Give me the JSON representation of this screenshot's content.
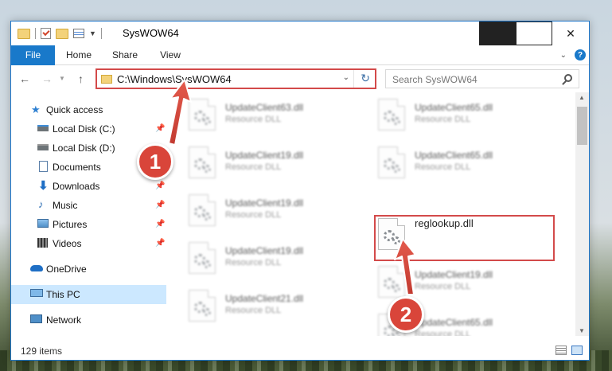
{
  "window": {
    "title": "SysWOW64"
  },
  "ribbon": {
    "tabs": [
      "File",
      "Home",
      "Share",
      "View"
    ]
  },
  "nav": {
    "address": "C:\\Windows\\SysWOW64",
    "search_placeholder": "Search SysWOW64"
  },
  "sidebar": {
    "items": [
      {
        "label": "Quick access",
        "icon": "star-icon"
      },
      {
        "label": "Local Disk (C:)",
        "icon": "drive-icon"
      },
      {
        "label": "Local Disk (D:)",
        "icon": "drive-icon"
      },
      {
        "label": "Documents",
        "icon": "documents-icon"
      },
      {
        "label": "Downloads",
        "icon": "download-icon"
      },
      {
        "label": "Music",
        "icon": "music-icon"
      },
      {
        "label": "Pictures",
        "icon": "pictures-icon"
      },
      {
        "label": "Videos",
        "icon": "videos-icon"
      },
      {
        "label": "OneDrive",
        "icon": "cloud-icon"
      },
      {
        "label": "This PC",
        "icon": "computer-icon"
      },
      {
        "label": "Network",
        "icon": "network-icon"
      }
    ],
    "selected": "This PC"
  },
  "files": {
    "left_column": [
      {
        "name": "UpdateClient63.dll",
        "type": "Resource DLL"
      },
      {
        "name": "UpdateClient19.dll",
        "type": "Resource DLL"
      },
      {
        "name": "UpdateClient19.dll",
        "type": "Resource DLL"
      },
      {
        "name": "UpdateClient19.dll",
        "type": "Resource DLL"
      },
      {
        "name": "UpdateClient21.dll",
        "type": "Resource DLL"
      }
    ],
    "right_column": [
      {
        "name": "UpdateClient65.dll",
        "type": "Resource DLL"
      },
      {
        "name": "UpdateClient65.dll",
        "type": "Resource DLL"
      },
      {
        "name": "reglookup.dll",
        "type": ""
      },
      {
        "name": "UpdateClient19.dll",
        "type": "Resource DLL"
      },
      {
        "name": "UpdateClient65.dll",
        "type": "Resource DLL"
      }
    ]
  },
  "status": {
    "item_count": "129 items"
  },
  "annotations": {
    "step1": "1",
    "step2": "2",
    "highlight_color": "#d34a4a",
    "badge_color": "#d9453a"
  },
  "colors": {
    "accent": "#1979ca",
    "selection": "#cce8ff"
  }
}
